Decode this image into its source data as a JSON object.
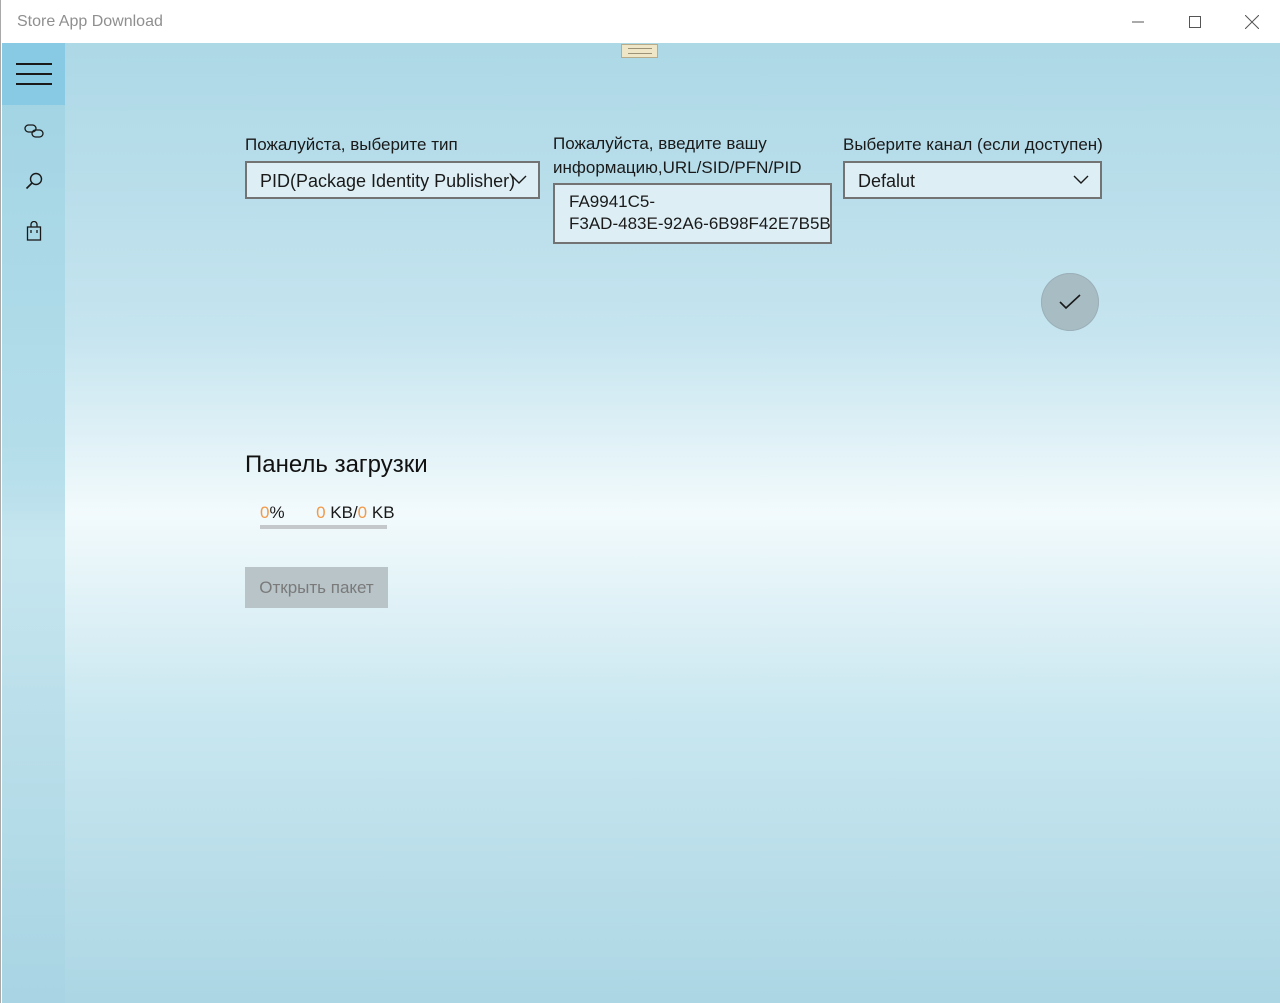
{
  "window": {
    "title": "Store App Download"
  },
  "sidebar": {
    "items": [
      {
        "icon": "link-icon"
      },
      {
        "icon": "search-icon"
      },
      {
        "icon": "shopping-bag-icon"
      }
    ]
  },
  "form": {
    "type_label": "Пожалуйста, выберите тип",
    "type_value": "PID(Package Identity Publisher)",
    "input_label_line1": "Пожалуйста, введите вашу",
    "input_label_line2": "информацию,URL/SID/PFN/PID",
    "input_value": "FA9941C5-\nF3AD-483E-92A6-6B98F42E7B5B",
    "channel_label": "Выберите канал (если доступен)",
    "channel_value": "Defalut"
  },
  "download": {
    "title": "Панель загрузки",
    "percent": "0",
    "percent_unit": "%",
    "downloaded": "0",
    "downloaded_unit": "KB/",
    "total": "0",
    "total_unit": "KB",
    "progress_fraction": 0,
    "open_button_label": "Открыть пакет"
  },
  "colors": {
    "accent_number": "#f29a4a",
    "hamburger_bg": "#88c9e4"
  }
}
